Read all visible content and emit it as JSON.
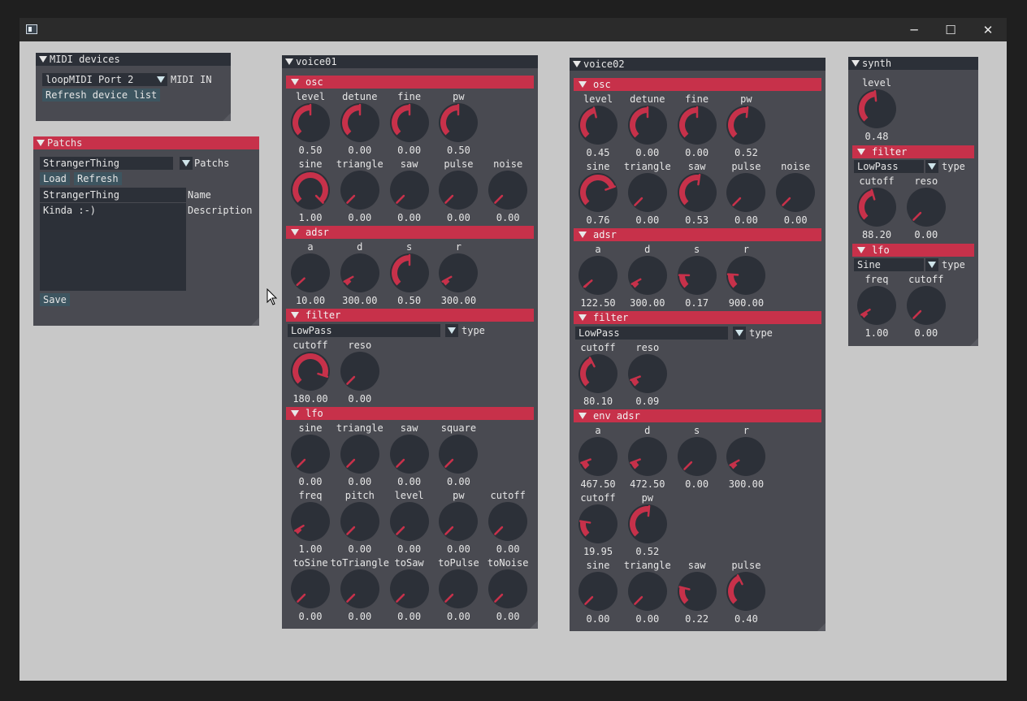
{
  "window": {
    "title": ""
  },
  "controls": {
    "minimize": "─",
    "maximize": "☐",
    "close": "✕"
  },
  "midi": {
    "title": "MIDI devices",
    "device": "loopMIDI Port 2",
    "device_label": "MIDI IN",
    "refresh": "Refresh device list"
  },
  "patchs": {
    "title": "Patchs",
    "selected": "StrangerThing",
    "selector_label": "Patchs",
    "load": "Load",
    "refresh": "Refresh",
    "name": "StrangerThing",
    "name_label": "Name",
    "description": "Kinda :-)",
    "description_label": "Description",
    "save": "Save"
  },
  "voice01": {
    "title": "voice01",
    "sections": [
      "osc",
      "adsr",
      "filter",
      "lfo"
    ],
    "filter_type": "LowPass",
    "filter_type_label": "type",
    "osc_row1": [
      {
        "label": "level",
        "value": "0.50",
        "fill": 0.5
      },
      {
        "label": "detune",
        "value": "0.00",
        "fill": 0.5
      },
      {
        "label": "fine",
        "value": "0.00",
        "fill": 0.5
      },
      {
        "label": "pw",
        "value": "0.50",
        "fill": 0.5
      }
    ],
    "osc_row2": [
      {
        "label": "sine",
        "value": "1.00",
        "fill": 1.0
      },
      {
        "label": "triangle",
        "value": "0.00",
        "fill": 0
      },
      {
        "label": "saw",
        "value": "0.00",
        "fill": 0
      },
      {
        "label": "pulse",
        "value": "0.00",
        "fill": 0
      },
      {
        "label": "noise",
        "value": "0.00",
        "fill": 0
      }
    ],
    "adsr": [
      {
        "label": "a",
        "value": "10.00",
        "fill": 0.01
      },
      {
        "label": "d",
        "value": "300.00",
        "fill": 0.06
      },
      {
        "label": "s",
        "value": "0.50",
        "fill": 0.5
      },
      {
        "label": "r",
        "value": "300.00",
        "fill": 0.06
      }
    ],
    "filter": [
      {
        "label": "cutoff",
        "value": "180.00",
        "fill": 0.9
      },
      {
        "label": "reso",
        "value": "0.00",
        "fill": 0
      }
    ],
    "lfo_row1": [
      {
        "label": "sine",
        "value": "0.00",
        "fill": 0
      },
      {
        "label": "triangle",
        "value": "0.00",
        "fill": 0
      },
      {
        "label": "saw",
        "value": "0.00",
        "fill": 0
      },
      {
        "label": "square",
        "value": "0.00",
        "fill": 0
      }
    ],
    "lfo_row2": [
      {
        "label": "freq",
        "value": "1.00",
        "fill": 0.05
      },
      {
        "label": "pitch",
        "value": "0.00",
        "fill": 0
      },
      {
        "label": "level",
        "value": "0.00",
        "fill": 0
      },
      {
        "label": "pw",
        "value": "0.00",
        "fill": 0
      },
      {
        "label": "cutoff",
        "value": "0.00",
        "fill": 0
      }
    ],
    "lfo_row3": [
      {
        "label": "toSine",
        "value": "0.00",
        "fill": 0
      },
      {
        "label": "toTriangle",
        "value": "0.00",
        "fill": 0
      },
      {
        "label": "toSaw",
        "value": "0.00",
        "fill": 0
      },
      {
        "label": "toPulse",
        "value": "0.00",
        "fill": 0
      },
      {
        "label": "toNoise",
        "value": "0.00",
        "fill": 0
      }
    ]
  },
  "voice02": {
    "title": "voice02",
    "sections": [
      "osc",
      "adsr",
      "filter",
      "env adsr"
    ],
    "filter_type": "LowPass",
    "filter_type_label": "type",
    "osc_row1": [
      {
        "label": "level",
        "value": "0.45",
        "fill": 0.45
      },
      {
        "label": "detune",
        "value": "0.00",
        "fill": 0.5
      },
      {
        "label": "fine",
        "value": "0.00",
        "fill": 0.5
      },
      {
        "label": "pw",
        "value": "0.52",
        "fill": 0.52
      }
    ],
    "osc_row2": [
      {
        "label": "sine",
        "value": "0.76",
        "fill": 0.76
      },
      {
        "label": "triangle",
        "value": "0.00",
        "fill": 0
      },
      {
        "label": "saw",
        "value": "0.53",
        "fill": 0.53
      },
      {
        "label": "pulse",
        "value": "0.00",
        "fill": 0
      },
      {
        "label": "noise",
        "value": "0.00",
        "fill": 0
      }
    ],
    "adsr": [
      {
        "label": "a",
        "value": "122.50",
        "fill": 0.02
      },
      {
        "label": "d",
        "value": "300.00",
        "fill": 0.06
      },
      {
        "label": "s",
        "value": "0.17",
        "fill": 0.17
      },
      {
        "label": "r",
        "value": "900.00",
        "fill": 0.18
      }
    ],
    "filter": [
      {
        "label": "cutoff",
        "value": "80.10",
        "fill": 0.4
      },
      {
        "label": "reso",
        "value": "0.09",
        "fill": 0.09
      }
    ],
    "env_row1": [
      {
        "label": "a",
        "value": "467.50",
        "fill": 0.09
      },
      {
        "label": "d",
        "value": "472.50",
        "fill": 0.09
      },
      {
        "label": "s",
        "value": "0.00",
        "fill": 0
      },
      {
        "label": "r",
        "value": "300.00",
        "fill": 0.06
      }
    ],
    "env_row2": [
      {
        "label": "cutoff",
        "value": "19.95",
        "fill": 0.2
      },
      {
        "label": "pw",
        "value": "0.52",
        "fill": 0.52
      }
    ],
    "env_row3": [
      {
        "label": "sine",
        "value": "0.00",
        "fill": 0
      },
      {
        "label": "triangle",
        "value": "0.00",
        "fill": 0
      },
      {
        "label": "saw",
        "value": "0.22",
        "fill": 0.22
      },
      {
        "label": "pulse",
        "value": "0.40",
        "fill": 0.4
      }
    ]
  },
  "synth": {
    "title": "synth",
    "level": {
      "label": "level",
      "value": "0.48",
      "fill": 0.48
    },
    "sections": [
      "filter",
      "lfo"
    ],
    "filter_type": "LowPass",
    "filter_type_label": "type",
    "filter": [
      {
        "label": "cutoff",
        "value": "88.20",
        "fill": 0.44
      },
      {
        "label": "reso",
        "value": "0.00",
        "fill": 0
      }
    ],
    "lfo_type": "Sine",
    "lfo_type_label": "type",
    "lfo": [
      {
        "label": "freq",
        "value": "1.00",
        "fill": 0.05
      },
      {
        "label": "cutoff",
        "value": "0.00",
        "fill": 0
      }
    ]
  },
  "colors": {
    "accent": "#c7314a",
    "knob": "#2c3038",
    "panel": "#494a51",
    "title": "#2c3038"
  }
}
